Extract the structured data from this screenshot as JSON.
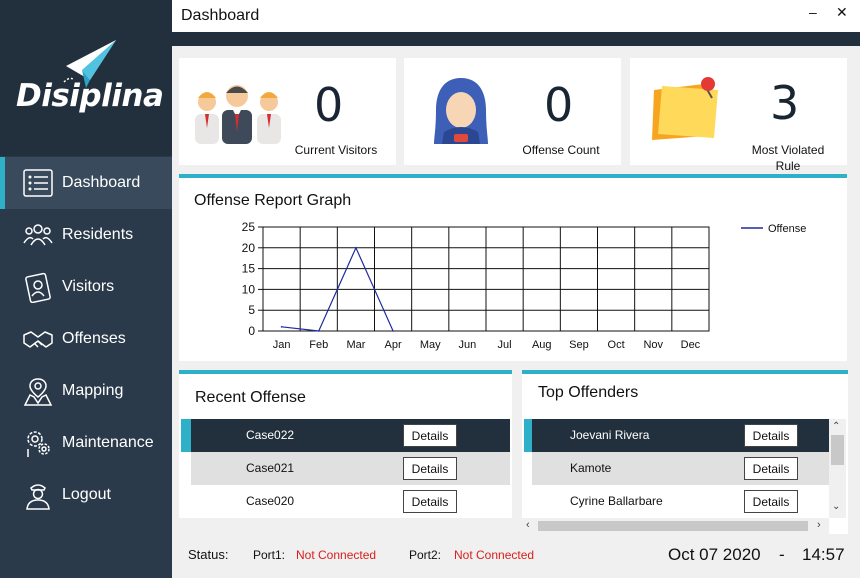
{
  "window": {
    "title": "Dashboard",
    "minimize": "–",
    "close": "✕"
  },
  "brand": {
    "name": "Disiplina"
  },
  "nav": [
    {
      "label": "Dashboard",
      "icon": "list-icon",
      "active": true
    },
    {
      "label": "Residents",
      "icon": "residents-icon"
    },
    {
      "label": "Visitors",
      "icon": "id-card-icon"
    },
    {
      "label": "Offenses",
      "icon": "handshake-icon"
    },
    {
      "label": "Mapping",
      "icon": "map-pin-icon"
    },
    {
      "label": "Maintenance",
      "icon": "gears-icon"
    },
    {
      "label": "Logout",
      "icon": "officer-icon"
    }
  ],
  "stats": {
    "visitors": {
      "value": "0",
      "label": "Current Visitors"
    },
    "offenses": {
      "value": "0",
      "label": "Offense Count"
    },
    "violated": {
      "value": "3",
      "label_line1": "Most Violated",
      "label_line2": "Rule"
    }
  },
  "graph": {
    "title": "Offense Report Graph",
    "legend": "Offense",
    "color": "#1f2a9c"
  },
  "chart_data": {
    "type": "line",
    "categories": [
      "Jan",
      "Feb",
      "Mar",
      "Apr",
      "May",
      "Jun",
      "Jul",
      "Aug",
      "Sep",
      "Oct",
      "Nov",
      "Dec"
    ],
    "series": [
      {
        "name": "Offense",
        "values": [
          1,
          0,
          20,
          0,
          null,
          null,
          null,
          null,
          null,
          null,
          null,
          null
        ]
      }
    ],
    "yticks": [
      0,
      5,
      10,
      15,
      20,
      25
    ],
    "ylim": [
      0,
      25
    ],
    "grid": true,
    "legend_position": "top-right"
  },
  "recent": {
    "title": "Recent Offense",
    "button_label": "Details",
    "rows": [
      {
        "case": "Case022"
      },
      {
        "case": "Case021"
      },
      {
        "case": "Case020"
      }
    ]
  },
  "top": {
    "title": "Top Offenders",
    "button_label": "Details",
    "rows": [
      {
        "name": "Joevani Rivera"
      },
      {
        "name": "Kamote"
      },
      {
        "name": "Cyrine Ballarbare"
      }
    ]
  },
  "statusbar": {
    "label": "Status:",
    "port1_label": "Port1:",
    "port1_value": "Not Connected",
    "port2_label": "Port2:",
    "port2_value": "Not Connected",
    "date": "Oct 07 2020",
    "separator": "-",
    "time": "14:57"
  }
}
